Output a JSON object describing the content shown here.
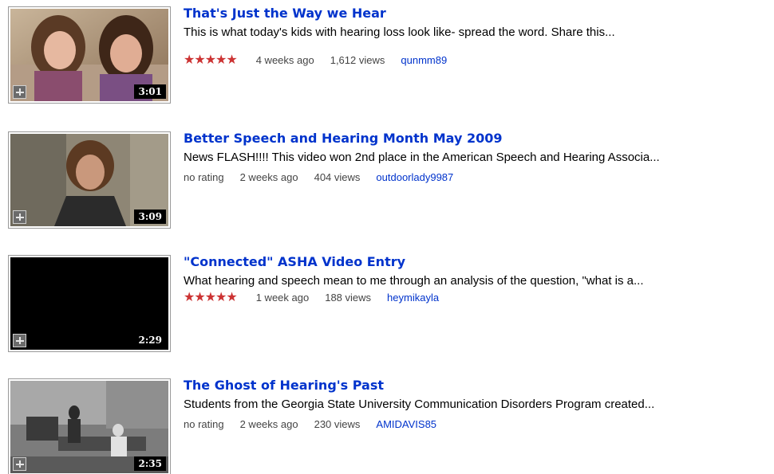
{
  "videos": [
    {
      "title": "That's Just the Way we Hear",
      "description": "This is what today's kids with hearing loss look like- spread the word. Share this...",
      "duration": "3:01",
      "rating": "★★★★★",
      "age": "4 weeks ago",
      "views": "1,612 views",
      "author": "qunmm89"
    },
    {
      "title": "Better Speech and Hearing Month May 2009",
      "description": "News FLASH!!!! This video won 2nd place in the American Speech and Hearing Associa...",
      "duration": "3:09",
      "rating": "no rating",
      "age": "2 weeks ago",
      "views": "404 views",
      "author": "outdoorlady9987"
    },
    {
      "title": "\"Connected\" ASHA Video Entry",
      "description": "What hearing and speech mean to me through an analysis of the question, \"what is a...",
      "duration": "2:29",
      "rating": "★★★★★",
      "age": "1 week ago",
      "views": "188 views",
      "author": "heymikayla"
    },
    {
      "title": "The Ghost of Hearing's Past",
      "description": "Students from the Georgia State University Communication Disorders Program created...",
      "duration": "2:35",
      "rating": "no rating",
      "age": "2 weeks ago",
      "views": "230 views",
      "author": "AMIDAVIS85"
    }
  ],
  "colors": {
    "link": "#0033cc",
    "stars": "#cc3333",
    "duration_bg": "#000000"
  },
  "icons": {
    "add": "plus-icon"
  }
}
